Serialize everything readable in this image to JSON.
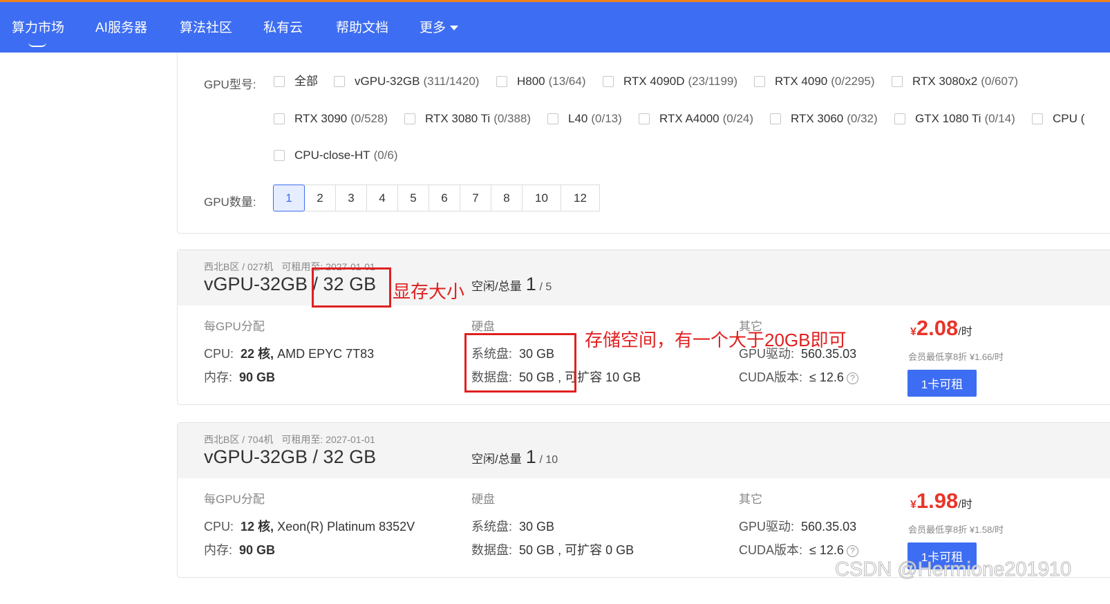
{
  "nav": {
    "items": [
      "算力市场",
      "AI服务器",
      "算法社区",
      "私有云",
      "帮助文档",
      "更多"
    ]
  },
  "filters": {
    "gpu_model_label": "GPU型号:",
    "gpu_models": [
      {
        "name": "全部",
        "count": ""
      },
      {
        "name": "vGPU-32GB",
        "count": "(311/1420)"
      },
      {
        "name": "H800",
        "count": "(13/64)"
      },
      {
        "name": "RTX 4090D",
        "count": "(23/1199)"
      },
      {
        "name": "RTX 4090",
        "count": "(0/2295)"
      },
      {
        "name": "RTX 3080x2",
        "count": "(0/607)"
      },
      {
        "name": "RTX 3090",
        "count": "(0/528)"
      },
      {
        "name": "RTX 3080 Ti",
        "count": "(0/388)"
      },
      {
        "name": "L40",
        "count": "(0/13)"
      },
      {
        "name": "RTX A4000",
        "count": "(0/24)"
      },
      {
        "name": "RTX 3060",
        "count": "(0/32)"
      },
      {
        "name": "GTX 1080 Ti",
        "count": "(0/14)"
      },
      {
        "name": "CPU (",
        "count": ""
      },
      {
        "name": "CPU-close-HT",
        "count": "(0/6)"
      }
    ],
    "gpu_count_label": "GPU数量:",
    "gpu_counts": [
      "1",
      "2",
      "3",
      "4",
      "5",
      "6",
      "7",
      "8",
      "10",
      "12"
    ],
    "gpu_count_selected": "1"
  },
  "cards": [
    {
      "region": "西北B区 / 027机",
      "rent_until": "可租用至: 2027-01-01",
      "title": "vGPU-32GB / 32 GB",
      "avail_label": "空闲/总量",
      "avail_free": "1",
      "avail_total": "/ 5",
      "alloc_label": "每GPU分配",
      "cpu_key": "CPU:",
      "cpu_cores": "22 核,",
      "cpu_model": "AMD EPYC 7T83",
      "mem_key": "内存:",
      "mem_val": "90 GB",
      "disk_label": "硬盘",
      "sys_key": "系统盘:",
      "sys_val": "30 GB",
      "data_key": "数据盘:",
      "data_val": "50 GB",
      "data_expand": ", 可扩容 10 GB",
      "other_label": "其它",
      "driver_key": "GPU驱动:",
      "driver_val": "560.35.03",
      "cuda_key": "CUDA版本:",
      "cuda_val": "≤ 12.6",
      "price_currency": "¥",
      "price_value": "2.08",
      "price_unit": "/时",
      "member_price": "会员最低享8折 ¥1.66/时",
      "rent_button": "1卡可租"
    },
    {
      "region": "西北B区 / 704机",
      "rent_until": "可租用至: 2027-01-01",
      "title": "vGPU-32GB / 32 GB",
      "avail_label": "空闲/总量",
      "avail_free": "1",
      "avail_total": "/ 10",
      "alloc_label": "每GPU分配",
      "cpu_key": "CPU:",
      "cpu_cores": "12 核,",
      "cpu_model": "Xeon(R) Platinum 8352V",
      "mem_key": "内存:",
      "mem_val": "90 GB",
      "disk_label": "硬盘",
      "sys_key": "系统盘:",
      "sys_val": "30 GB",
      "data_key": "数据盘:",
      "data_val": "50 GB",
      "data_expand": ", 可扩容 0 GB",
      "other_label": "其它",
      "driver_key": "GPU驱动:",
      "driver_val": "560.35.03",
      "cuda_key": "CUDA版本:",
      "cuda_val": "≤ 12.6",
      "price_currency": "¥",
      "price_value": "1.98",
      "price_unit": "/时",
      "member_price": "会员最低享8折 ¥1.58/时",
      "rent_button": "1卡可租"
    }
  ],
  "annotations": {
    "vram": "显存大小",
    "storage": "存储空间，有一个大于20GB即可",
    "color": "#e02020"
  },
  "watermark": "CSDN @Hermione201910",
  "colors": {
    "nav_bg": "#3d6df2",
    "accent_top": "#f0821e",
    "price": "#e8352a"
  }
}
